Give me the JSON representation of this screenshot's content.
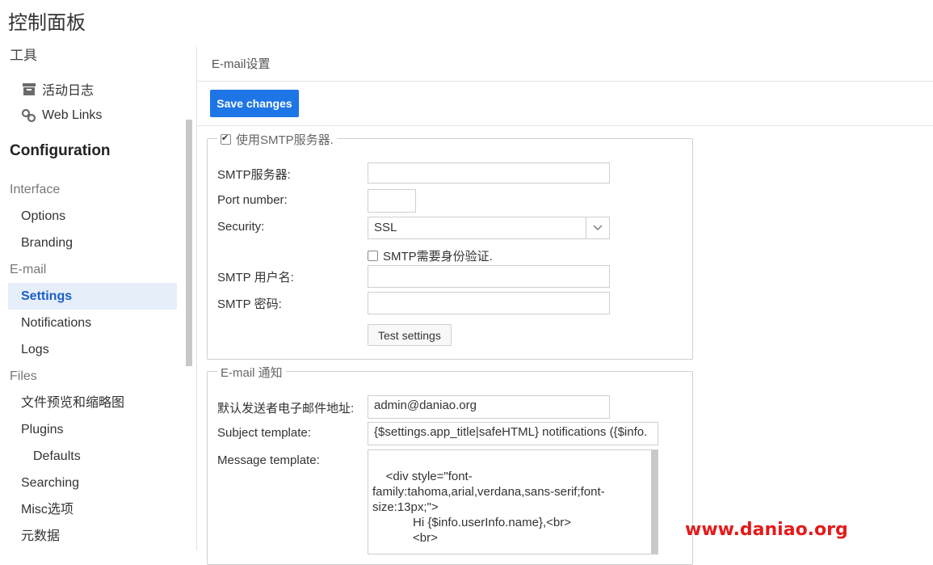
{
  "page": {
    "title": "控制面板"
  },
  "sidebar": {
    "tools_label": "工具",
    "tools": [
      {
        "label": "活动日志",
        "icon": "archive-icon"
      },
      {
        "label": "Web Links",
        "icon": "link-icon"
      }
    ],
    "config_title": "Configuration",
    "nav": [
      {
        "label": "Interface",
        "kind": "group"
      },
      {
        "label": "Options",
        "kind": "item"
      },
      {
        "label": "Branding",
        "kind": "item"
      },
      {
        "label": "E-mail",
        "kind": "group"
      },
      {
        "label": "Settings",
        "kind": "item",
        "active": true
      },
      {
        "label": "Notifications",
        "kind": "item"
      },
      {
        "label": "Logs",
        "kind": "item"
      },
      {
        "label": "Files",
        "kind": "group"
      },
      {
        "label": "文件预览和缩略图",
        "kind": "item"
      },
      {
        "label": "Plugins",
        "kind": "item"
      },
      {
        "label": "Defaults",
        "kind": "sub2"
      },
      {
        "label": "Searching",
        "kind": "item"
      },
      {
        "label": "Misc选项",
        "kind": "item"
      },
      {
        "label": "元数据",
        "kind": "item"
      }
    ]
  },
  "content": {
    "header": "E-mail设置",
    "save_label": "Save changes"
  },
  "smtp": {
    "legend": "使用SMTP服务器.",
    "enabled": true,
    "server_label": "SMTP服务器:",
    "server_value": "",
    "port_label": "Port number:",
    "port_value": "",
    "security_label": "Security:",
    "security_value": "SSL",
    "auth_label": "SMTP需要身份验证.",
    "auth_checked": false,
    "user_label": "SMTP 用户名:",
    "user_value": "",
    "password_label": "SMTP 密码:",
    "password_value": "",
    "test_label": "Test settings"
  },
  "notify": {
    "legend": "E-mail 通知",
    "sender_label": "默认发送者电子邮件地址:",
    "sender_value": "admin@daniao.org",
    "subject_label": "Subject template:",
    "subject_value": "{$settings.app_title|safeHTML} notifications ({$info.",
    "message_label": "Message template:",
    "message_value": "<div style=\"font-family:tahoma,arial,verdana,sans-serif;font-size:13px;\">\n            Hi {$info.userInfo.name},<br>\n            <br>\n\n            {foreach from=$info.actions\nitem=action}"
  },
  "watermark": "www.daniao.org",
  "colors": {
    "primary": "#1e75e6",
    "active_bg": "#e6eefa",
    "active_text": "#1a5fc4",
    "watermark": "#e31b1b"
  }
}
